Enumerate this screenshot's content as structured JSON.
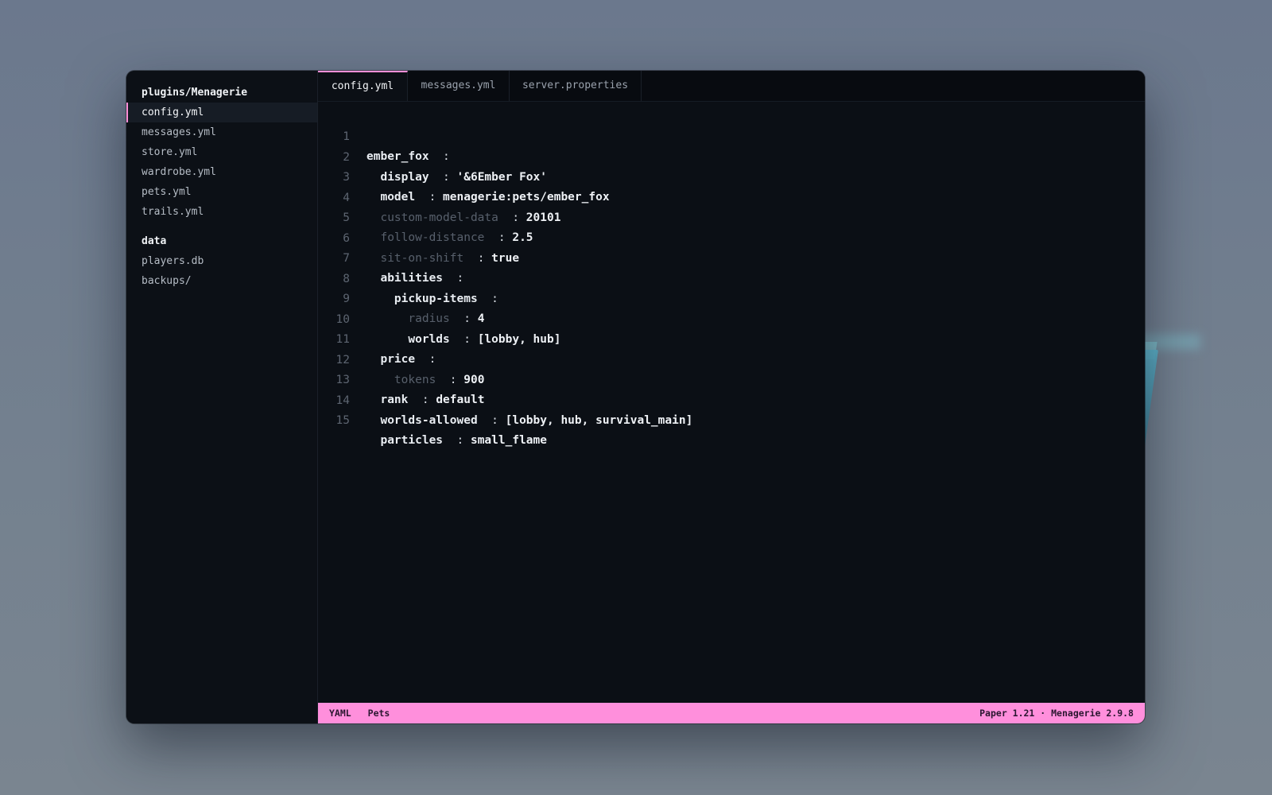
{
  "sidebar": {
    "groups": [
      {
        "title": "plugins/Menagerie",
        "items": [
          "config.yml",
          "messages.yml",
          "store.yml",
          "wardrobe.yml",
          "pets.yml",
          "trails.yml"
        ]
      },
      {
        "title": "data",
        "items": [
          "players.db",
          "backups/"
        ]
      }
    ],
    "active_item": "config.yml"
  },
  "tabs": [
    "config.yml",
    "messages.yml",
    "server.properties"
  ],
  "active_tab": "config.yml",
  "code_lines": [
    {
      "n": "1",
      "key": "ember_fox",
      "value": ""
    },
    {
      "n": "2",
      "key": "display",
      "value": "'&6Ember Fox'"
    },
    {
      "n": "3",
      "key": "model",
      "value": "menagerie:pets/ember_fox"
    },
    {
      "n": "4",
      "key": "custom-model-data",
      "value": "20101"
    },
    {
      "n": "5",
      "key": "follow-distance",
      "value": "2.5"
    },
    {
      "n": "6",
      "key": "sit-on-shift",
      "value": "true"
    },
    {
      "n": "7",
      "key": "abilities",
      "value": ""
    },
    {
      "n": "8",
      "key": "pickup-items",
      "value": ""
    },
    {
      "n": "9",
      "key": "radius",
      "value": "4"
    },
    {
      "n": "10",
      "key": "worlds",
      "value": "[lobby, hub]"
    },
    {
      "n": "11",
      "key": "price",
      "value": ""
    },
    {
      "n": "12",
      "key": "tokens",
      "value": "900"
    },
    {
      "n": "13",
      "key": "rank",
      "value": "default"
    },
    {
      "n": "14",
      "key": "worlds-allowed",
      "value": "[lobby, hub, survival_main]"
    },
    {
      "n": "15",
      "key": "particles",
      "value": "small_flame"
    }
  ],
  "status": {
    "language": "YAML",
    "section": "Pets",
    "right": "Paper 1.21 · Menagerie 2.9.8"
  },
  "colors": {
    "accent": "#ff8fdc",
    "editor_bg": "#0b0f15",
    "dim_key": "#58606c"
  }
}
